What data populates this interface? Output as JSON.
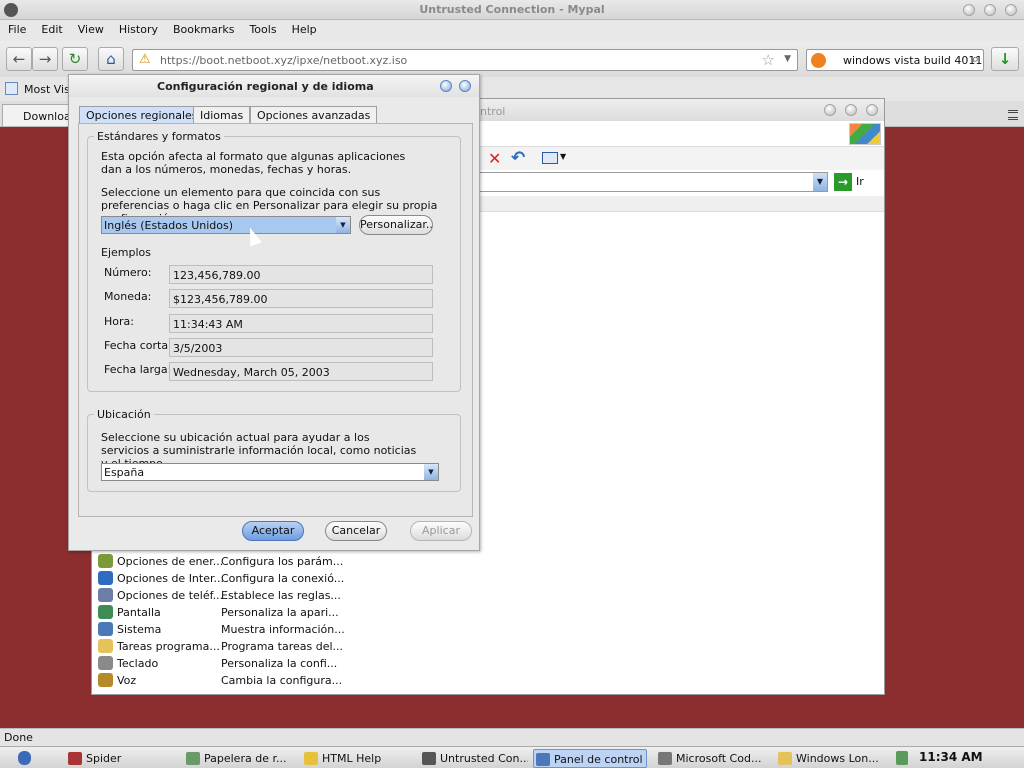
{
  "browser": {
    "title": "Untrusted Connection - Mypal",
    "menu": [
      "File",
      "Edit",
      "View",
      "History",
      "Bookmarks",
      "Tools",
      "Help"
    ],
    "url": "https://boot.netboot.xyz/ipxe/netboot.xyz.iso",
    "search_value": "windows vista build 4011",
    "bookmark": "Most Visit",
    "tab_label": "Downloac",
    "status": "Done"
  },
  "control_panel": {
    "title_fragment": "ntrol",
    "go_label": "Ir",
    "items": [
      {
        "name": "Opciones de ener...",
        "desc": "Configura los parám...",
        "icon": "power-icon",
        "color": "#7a9a3a"
      },
      {
        "name": "Opciones de Inter...",
        "desc": "Configura la conexió...",
        "icon": "globe-icon",
        "color": "#2e6cc0"
      },
      {
        "name": "Opciones de teléf...",
        "desc": "Establece las reglas...",
        "icon": "phone-icon",
        "color": "#6d7ea8"
      },
      {
        "name": "Pantalla",
        "desc": "Personaliza la apari...",
        "icon": "display-icon",
        "color": "#3f8b55"
      },
      {
        "name": "Sistema",
        "desc": "Muestra información...",
        "icon": "system-icon",
        "color": "#4c77b8"
      },
      {
        "name": "Tareas programa...",
        "desc": "Programa tareas del...",
        "icon": "folder-clock-icon",
        "color": "#e6c25a"
      },
      {
        "name": "Teclado",
        "desc": "Personaliza la confi...",
        "icon": "keyboard-icon",
        "color": "#8a8a8a"
      },
      {
        "name": "Voz",
        "desc": "Cambia la configura...",
        "icon": "microphone-icon",
        "color": "#b58a2a"
      }
    ]
  },
  "dialog": {
    "title": "Configuración regional y de idioma",
    "tabs": [
      "Opciones regionales",
      "Idiomas",
      "Opciones avanzadas"
    ],
    "standards": {
      "legend": "Estándares y formatos",
      "desc1": "Esta opción afecta al formato que algunas aplicaciones dan a los números, monedas, fechas y horas.",
      "desc2": "Seleccione un elemento para que coincida con sus preferencias o haga clic en Personalizar para elegir su propia configuración:",
      "selected": "Inglés (Estados Unidos)",
      "customize": "Personalizar...",
      "examples_label": "Ejemplos",
      "examples": [
        {
          "label": "Número:",
          "value": "123,456,789.00"
        },
        {
          "label": "Moneda:",
          "value": "$123,456,789.00"
        },
        {
          "label": "Hora:",
          "value": "11:34:43 AM"
        },
        {
          "label": "Fecha corta:",
          "value": "3/5/2003"
        },
        {
          "label": "Fecha larga:",
          "value": "Wednesday, March 05, 2003"
        }
      ]
    },
    "location": {
      "legend": "Ubicación",
      "desc": "Seleccione su ubicación actual para ayudar a los servicios a suministrarle información local, como noticias y el tiempo.",
      "selected": "España"
    },
    "buttons": {
      "ok": "Aceptar",
      "cancel": "Cancelar",
      "apply": "Aplicar"
    }
  },
  "taskbar": {
    "items": [
      {
        "label": "Spider",
        "icon": "spider-icon",
        "color": "#a33"
      },
      {
        "label": "Papelera de r...",
        "icon": "recycle-bin-icon",
        "color": "#6a9a6a"
      },
      {
        "label": "HTML Help",
        "icon": "help-icon",
        "color": "#e6c23a"
      },
      {
        "label": "Untrusted Con...",
        "icon": "mypal-icon",
        "color": "#555"
      },
      {
        "label": "Panel de control",
        "icon": "control-panel-icon",
        "color": "#4c77b8"
      },
      {
        "label": "Microsoft Cod...",
        "icon": "code-icon",
        "color": "#777"
      },
      {
        "label": "Windows Lon...",
        "icon": "folder-icon",
        "color": "#e6c25a"
      }
    ],
    "clock": "11:34 AM"
  },
  "colors": {
    "desktop": "#8c2d30",
    "accent": "#6f9be0"
  }
}
